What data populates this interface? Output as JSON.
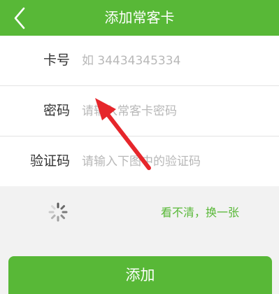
{
  "navbar": {
    "back_icon": "chevron-left-icon",
    "title": "添加常客卡",
    "color": "#58b837"
  },
  "form": {
    "card_number": {
      "label": "卡号",
      "placeholder": "如 34434345334",
      "value": ""
    },
    "password": {
      "label": "密码",
      "placeholder": "请输入常客卡密码",
      "value": ""
    },
    "captcha": {
      "label": "验证码",
      "placeholder": "请输入下图中的验证码",
      "value": ""
    }
  },
  "captcha_area": {
    "loading_icon": "spinner-icon",
    "refresh_label": "看不清，换一张"
  },
  "submit": {
    "label": "添加"
  },
  "annotation": {
    "arrow_icon": "red-arrow-icon",
    "color": "#e6262b"
  }
}
